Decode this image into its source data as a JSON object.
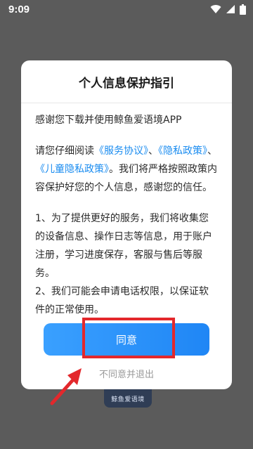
{
  "status_bar": {
    "time": "9:09"
  },
  "dialog": {
    "title": "个人信息保护指引",
    "intro": "感谢您下载并使用鲸鱼爱语境APP",
    "para1": {
      "lead": "请您仔细阅读",
      "link1": "《服务协议》",
      "sep1": "、",
      "link2": "《隐私政策》",
      "sep2": "、",
      "link3": "《儿童隐私政策》",
      "tail": "。我们将严格按照政策内容保护好您的个人信息，感谢您的信任。"
    },
    "item1": "1、为了提供更好的服务，我们将收集您的设备信息、操作日志等信息，用于账户注册，学习进度保存，客服与售后等服务。",
    "item2": "2、我们可能会申请电话权限，以保证软件的正常使用。",
    "agree_label": "同意",
    "decline_label": "不同意并退出"
  },
  "background_logo": {
    "text": "鲸鱼爱语境"
  },
  "colors": {
    "accent": "#1a8cf0",
    "highlight": "#e3282c"
  }
}
